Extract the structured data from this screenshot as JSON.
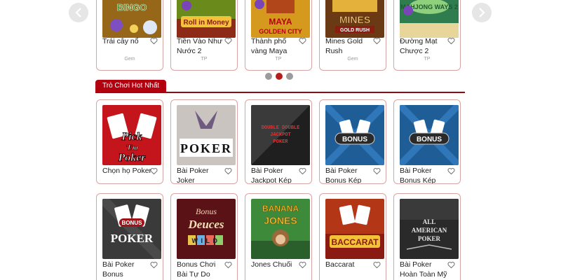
{
  "carousel": {
    "prev_icon": "chevron-left",
    "next_icon": "chevron-right",
    "items": [
      {
        "title": "Trái cây nổ",
        "provider": "Gem",
        "art": "Bingo"
      },
      {
        "title": "Tiền Vào Như Nước 2",
        "provider": "TP",
        "art": "Roll in Money"
      },
      {
        "title": "Thành phố vàng Maya",
        "provider": "TP",
        "art": "Maya Golden City"
      },
      {
        "title": "Mines Gold Rush",
        "provider": "Gem",
        "art": "Mines Gold Rush"
      },
      {
        "title": "Đường Mạt Chược 2",
        "provider": "TP",
        "art": "Mahjong Ways 2"
      }
    ],
    "pagination": {
      "total": 3,
      "active": 1
    }
  },
  "section": {
    "title": "Trò Chơi Hot Nhất"
  },
  "games": [
    {
      "title": "Chọn họ Poker",
      "art": "Pick 'Em Poker"
    },
    {
      "title": "Bài Poker Joker",
      "art": "Joker Poker"
    },
    {
      "title": "Bài Poker Jackpot Kép Kép",
      "art": "Double Double Jackpot Poker"
    },
    {
      "title": "Bài Poker Bonus Kép Kép",
      "art": "Bonus Deuces"
    },
    {
      "title": "Bài Poker Bonus Kép",
      "art": "Bonus"
    },
    {
      "title": "Bài Poker Bonus",
      "art": "Bonus Poker"
    },
    {
      "title": "Bonus Chơi Bài Tự Do",
      "art": "Bonus Deuces Wild"
    },
    {
      "title": "Jones Chuối",
      "art": "Banana Jones"
    },
    {
      "title": "Baccarat",
      "art": "Baccarat"
    },
    {
      "title": "Bài Poker Hoàn Toàn Mỹ",
      "art": "All American Poker"
    }
  ],
  "colors": {
    "accent": "#b3000f",
    "card_border": "#d9a4a4",
    "dot_inactive": "#9b9b9b",
    "dot_active": "#b71c1c"
  },
  "icons": {
    "favorite": "heart-outline-icon"
  }
}
